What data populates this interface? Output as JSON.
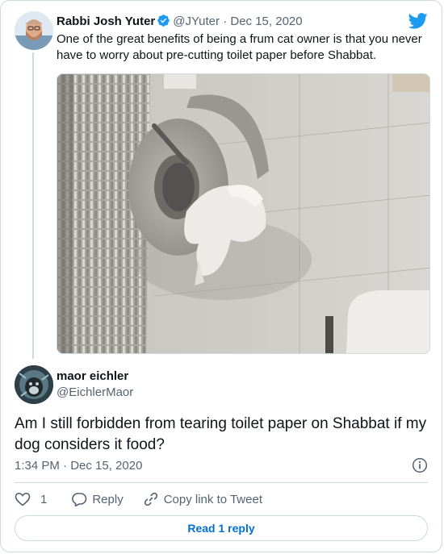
{
  "quoted_tweet": {
    "author_name": "Rabbi Josh Yuter",
    "handle": "@JYuter",
    "separator": "·",
    "date": "Dec 15, 2020",
    "text": "One of the great benefits of being a frum cat owner is that you never have to worry about pre-cutting toilet paper before Shabbat.",
    "verified": true,
    "photo_icon": "photo-of-shredded-toilet-paper-roll"
  },
  "tweet": {
    "author_name": "maor eichler",
    "handle": "@EichlerMaor",
    "text": "Am I still forbidden from tearing toilet paper on Shabbat if my dog considers it food?",
    "timestamp": "1:34 PM · Dec 15, 2020"
  },
  "actions": {
    "like_count": "1",
    "reply_label": "Reply",
    "copy_link_label": "Copy link to Tweet"
  },
  "read_reply_label": "Read 1 reply",
  "colors": {
    "twitter_blue": "#1d9bf0",
    "link_blue": "#006fd6",
    "secondary_text": "#536471",
    "border": "#cfd9de"
  }
}
